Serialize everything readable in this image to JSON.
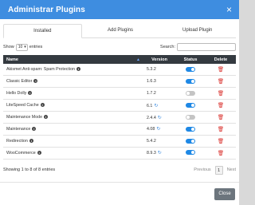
{
  "header": {
    "title": "Administrar Plugins",
    "close_glyph": "×"
  },
  "tabs": [
    {
      "label": "Installed",
      "active": true
    },
    {
      "label": "Add Plugins",
      "active": false
    },
    {
      "label": "Upload Plugin",
      "active": false
    }
  ],
  "controls": {
    "show_label": "Show",
    "page_size": "10",
    "entries_label": "entries",
    "search_label": "Search:",
    "search_value": ""
  },
  "table": {
    "headers": {
      "name": "Name",
      "version": "Version",
      "status": "Status",
      "delete": "Delete"
    },
    "rows": [
      {
        "name": "Akismet Anti-spam: Spam Protection",
        "version": "5.3.2",
        "active": true,
        "update": false
      },
      {
        "name": "Classic Editor",
        "version": "1.6.3",
        "active": true,
        "update": false
      },
      {
        "name": "Hello Dolly",
        "version": "1.7.2",
        "active": false,
        "update": false
      },
      {
        "name": "LiteSpeed Cache",
        "version": "6.1",
        "active": true,
        "update": true
      },
      {
        "name": "Maintenance Mode",
        "version": "2.4.4",
        "active": false,
        "update": true
      },
      {
        "name": "Maintenance",
        "version": "4.08",
        "active": true,
        "update": true
      },
      {
        "name": "Redirection",
        "version": "5.4.2",
        "active": true,
        "update": false
      },
      {
        "name": "WooCommerce",
        "version": "8.9.3",
        "active": true,
        "update": true
      }
    ]
  },
  "footer": {
    "info": "Showing 1 to 8 of 8 entries",
    "previous": "Previous",
    "page": "1",
    "next": "Next"
  },
  "close_button": "Close",
  "colors": {
    "header_bg": "#3e8de0",
    "table_head_bg": "#343a40",
    "toggle_on": "#1e88e5",
    "delete": "#d9302c"
  }
}
